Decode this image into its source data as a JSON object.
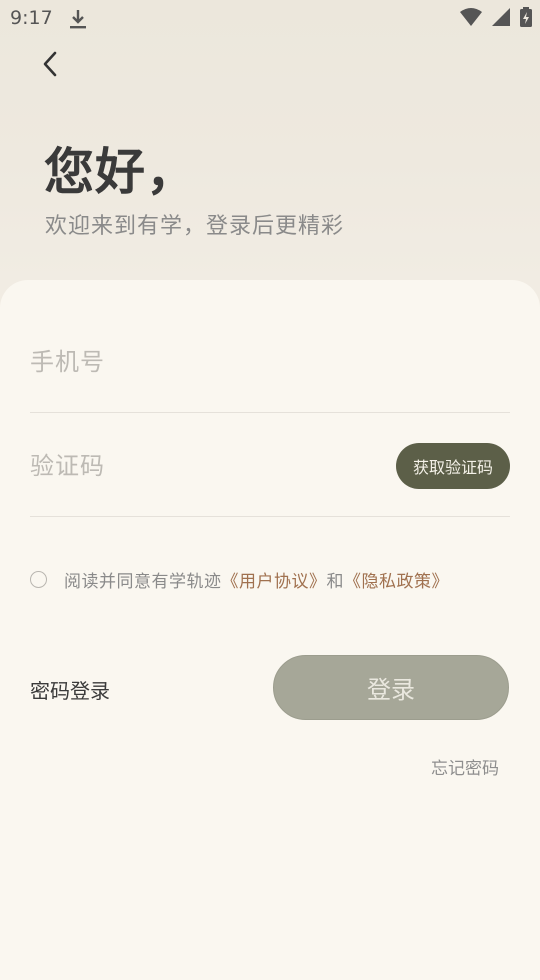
{
  "status_bar": {
    "time": "9:17",
    "icons": [
      "download-icon",
      "wifi-icon",
      "signal-icon",
      "battery-icon"
    ]
  },
  "header": {
    "back_icon": "chevron-left-icon",
    "greeting": "您好，",
    "subtitle": "欢迎来到有学，登录后更精彩"
  },
  "form": {
    "phone_placeholder": "手机号",
    "code_placeholder": "验证码",
    "get_code_label": "获取验证码"
  },
  "agreement": {
    "checked": false,
    "prefix": "阅读并同意有学轨迹",
    "user_agreement": "《用户协议》",
    "conjunction": "和",
    "privacy_policy": "《隐私政策》"
  },
  "actions": {
    "password_login": "密码登录",
    "login": "登录",
    "forgot_password": "忘记密码"
  },
  "colors": {
    "primary_button": "#5c5f48",
    "login_button_disabled": "#a6a798",
    "link": "#a0714f",
    "card_bg": "#faf7f0"
  }
}
